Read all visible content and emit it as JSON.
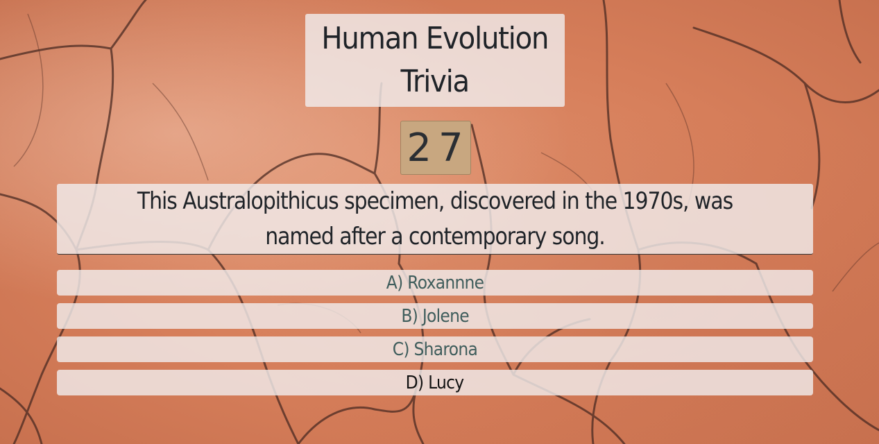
{
  "game": {
    "title_line1": "Human Evolution",
    "title_line2": "Trivia",
    "timer": "27",
    "question": "This Australopithicus specimen, discovered in the 1970s, was named after a contemporary song.",
    "answers": [
      {
        "label": "A) Roxannne",
        "selected": false
      },
      {
        "label": "B) Jolene",
        "selected": false
      },
      {
        "label": "C) Sharona",
        "selected": false
      },
      {
        "label": "D) Lucy",
        "selected": true
      }
    ]
  },
  "colors": {
    "background": "#d67e5a",
    "panel": "#f0ecec",
    "timer_bg": "#c8a780",
    "text_dark": "#1f2328",
    "answer_text": "#3f5d5c"
  }
}
